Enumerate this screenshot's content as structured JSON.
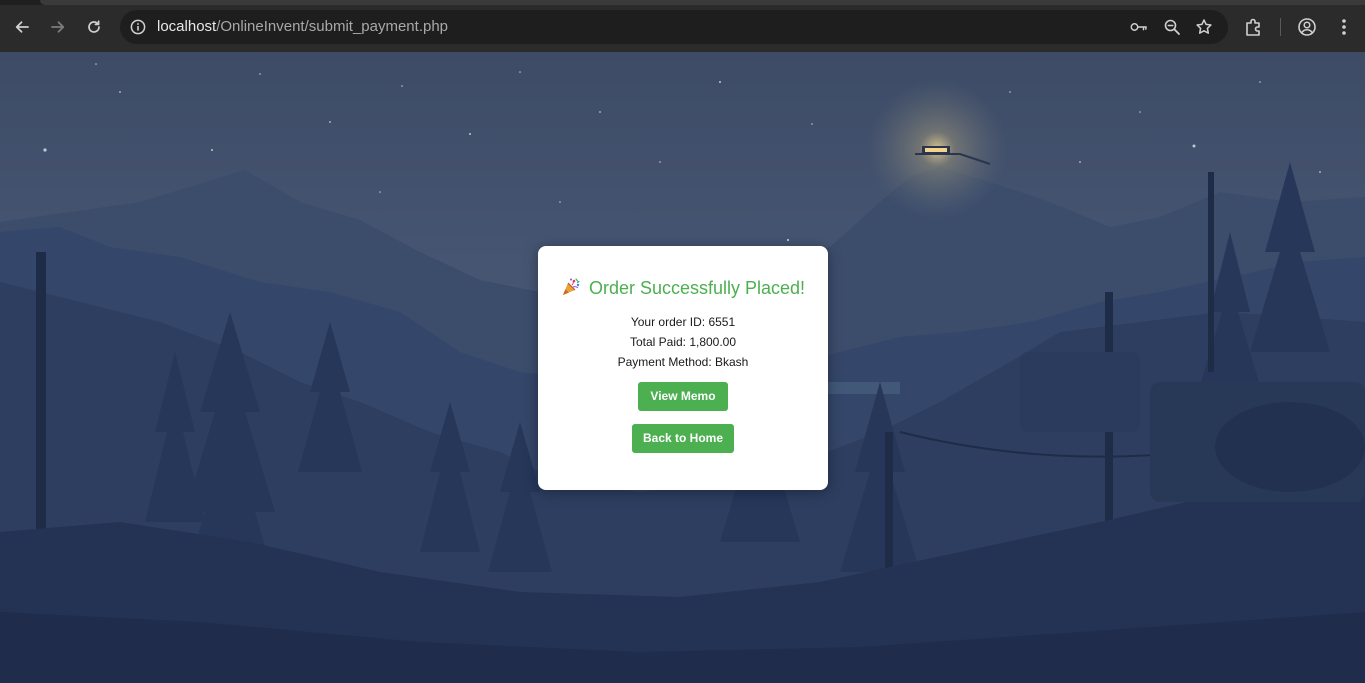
{
  "browser": {
    "url_host": "localhost",
    "url_path": "/OnlineInvent/submit_payment.php",
    "nav": {
      "back_icon": "arrow-left-icon",
      "forward_icon": "arrow-right-icon",
      "reload_icon": "reload-icon"
    },
    "omnibox_icons": [
      "site-info-icon",
      "key-icon",
      "zoom-icon",
      "star-icon"
    ],
    "toolbar_icons": [
      "extensions-icon",
      "profile-icon",
      "menu-kebab-icon"
    ]
  },
  "card": {
    "title": "Order Successfully Placed!",
    "title_icon": "party-popper-icon",
    "order_id_line": "Your order ID: 6551",
    "total_paid_line": "Total Paid: 1,800.00",
    "payment_method_line": "Payment Method: Bkash",
    "view_memo_label": "View Memo",
    "back_home_label": "Back to Home"
  },
  "colors": {
    "chrome_bg": "#2b2b2b",
    "omnibox_bg": "#1e1e1e",
    "accent_green": "#4caf50",
    "card_bg": "#ffffff",
    "sky": "#4a5a77",
    "forest": "#243253"
  }
}
